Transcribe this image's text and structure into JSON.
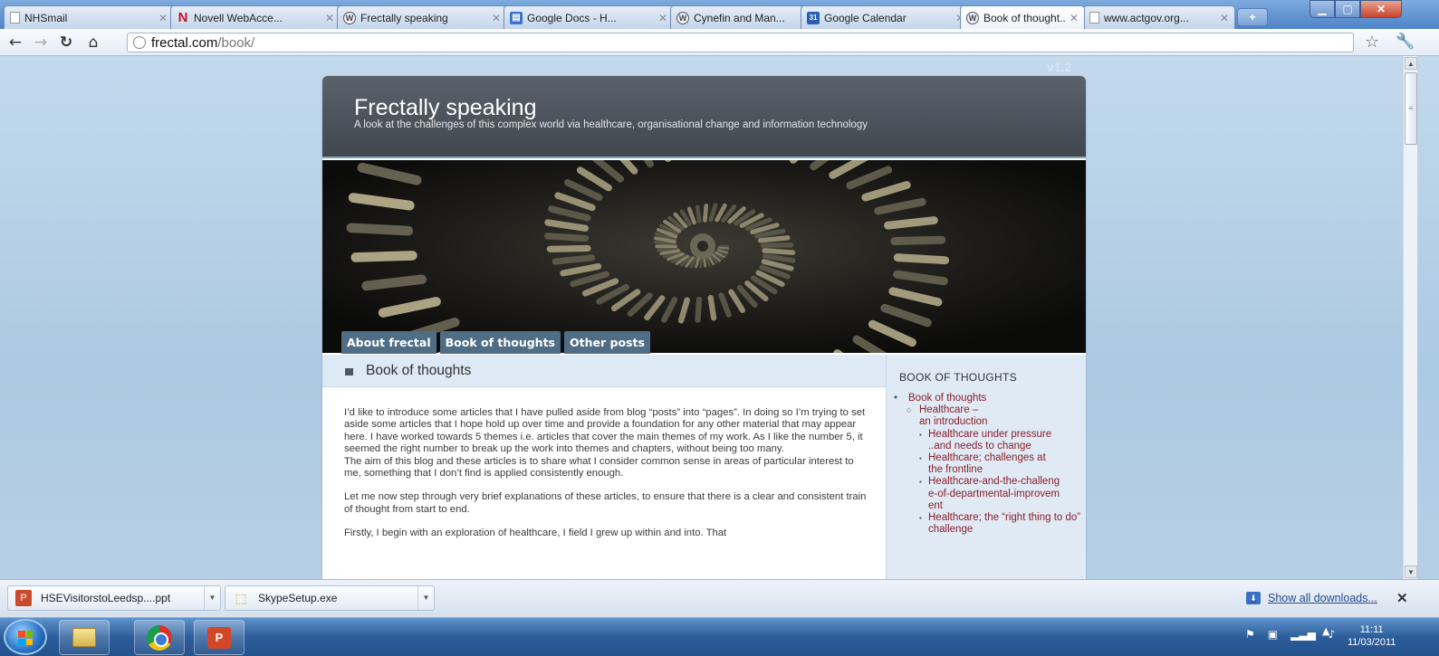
{
  "browser": {
    "tabs": [
      {
        "title": "NHSmail",
        "icon": "page-icon"
      },
      {
        "title": "Novell WebAcce...",
        "icon": "novell-icon"
      },
      {
        "title": "Frectally speaking",
        "icon": "wordpress-icon"
      },
      {
        "title": "Google Docs - H...",
        "icon": "google-docs-icon"
      },
      {
        "title": "Cynefin and Man...",
        "icon": "wordpress-icon"
      },
      {
        "title": "Google Calendar",
        "icon": "google-calendar-icon",
        "icon_text": "31"
      },
      {
        "title": "Book of thought...",
        "icon": "wordpress-icon",
        "active": true
      },
      {
        "title": "www.actgov.org...",
        "icon": "page-icon"
      }
    ],
    "url_host": "frectal.com",
    "url_path": "/book/"
  },
  "site": {
    "version": "v1.2",
    "title": "Frectally speaking",
    "tagline": "A look at the challenges of this complex world via healthcare, organisational change and information technology",
    "nav": [
      "About frectal",
      "Book of thoughts",
      "Other posts"
    ],
    "page_title": "Book of thoughts",
    "article": {
      "p1": "I’d like to introduce some articles that I have pulled aside from blog “posts” into “pages”. In doing so I’m trying to set aside some articles that I hope hold up over time and provide a foundation for any other material that may appear here. I have worked towards 5 themes i.e. articles that cover the main themes of my work. As I like the number 5, it seemed the right number to break up the work into themes and chapters, without being too many.",
      "p1b": "The aim of this blog and these articles is to share what I consider common sense in areas of particular interest to me, something that I don’t find is applied consistently enough.",
      "p2": "Let me now step through very brief explanations of these articles, to ensure that there is a clear and consistent train of thought from start to end.",
      "p3": "Firstly, I begin with an exploration of healthcare, I field I grew up within and into. That"
    },
    "sidebar": {
      "heading": "BOOK OF THOUGHTS",
      "root": "Book of thoughts",
      "sub": "Healthcare –\nan introduction",
      "items": [
        "Healthcare under pressure ..and needs to change",
        "Healthcare; challenges at the frontline",
        "Healthcare-and-the-challenge-of-departmental-improvement",
        "Healthcare; the “right thing to do” challenge"
      ]
    }
  },
  "downloads": {
    "items": [
      {
        "name": "HSEVisitorstoLeedsp....ppt",
        "icon": "powerpoint-file-icon"
      },
      {
        "name": "SkypeSetup.exe",
        "icon": "installer-icon"
      }
    ],
    "show_all": "Show all downloads..."
  },
  "taskbar": {
    "time": "11:11",
    "date": "11/03/2011"
  }
}
